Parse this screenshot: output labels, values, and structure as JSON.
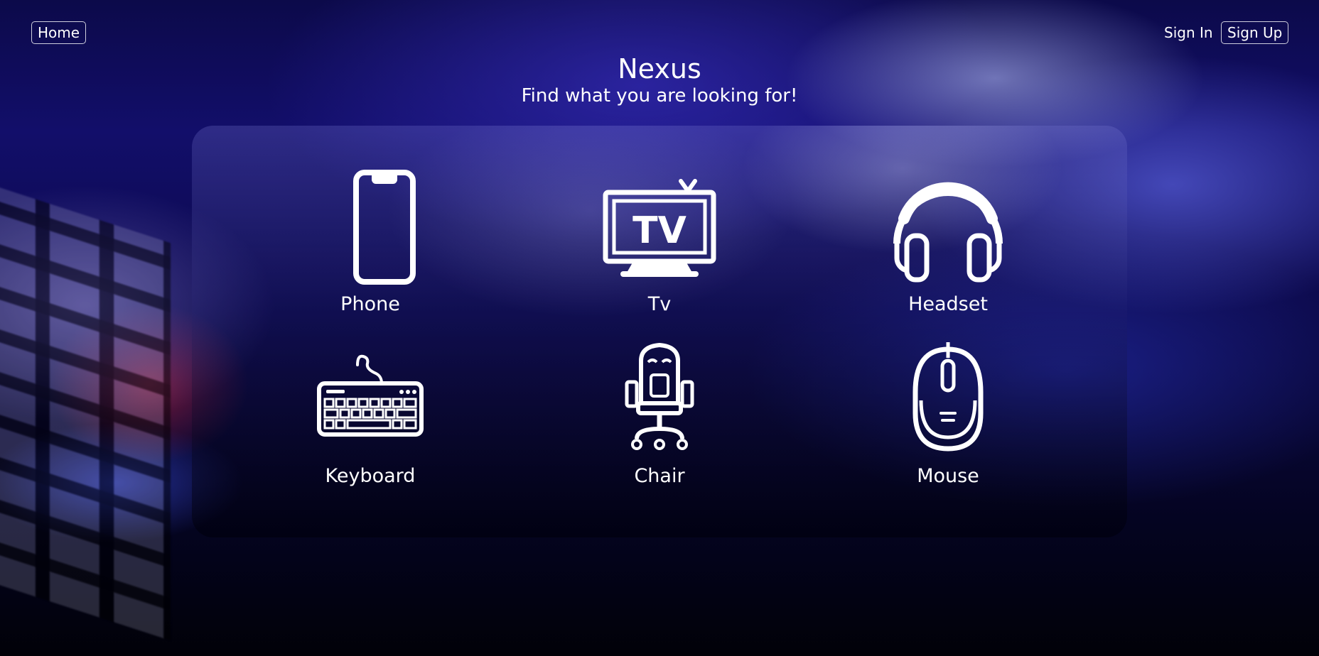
{
  "header": {
    "home_label": "Home",
    "sign_in_label": "Sign In",
    "sign_up_label": "Sign Up",
    "title": "Nexus",
    "subtitle": "Find what you are looking for!"
  },
  "categories": [
    {
      "label": "Phone",
      "icon": "phone-icon"
    },
    {
      "label": "Tv",
      "icon": "tv-icon"
    },
    {
      "label": "Headset",
      "icon": "headset-icon"
    },
    {
      "label": "Keyboard",
      "icon": "keyboard-icon"
    },
    {
      "label": "Chair",
      "icon": "chair-icon"
    },
    {
      "label": "Mouse",
      "icon": "mouse-icon"
    }
  ]
}
